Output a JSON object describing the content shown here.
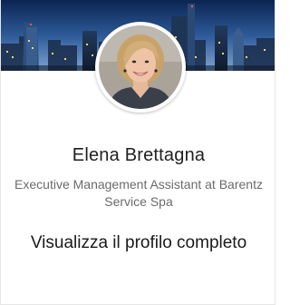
{
  "profile": {
    "name": "Elena Brettagna",
    "headline": "Executive Management Assistant at Barentz Service Spa",
    "view_profile_label": "Visualizza il profilo completo"
  },
  "images": {
    "cover": "city-skyline-night-cover",
    "avatar": "profile-photo-woman-smiling"
  },
  "colors": {
    "name_text": "#1f1f1f",
    "headline_text": "#6b6b6b",
    "link_text": "#1a1a1a",
    "card_border": "#e6e6e6"
  }
}
